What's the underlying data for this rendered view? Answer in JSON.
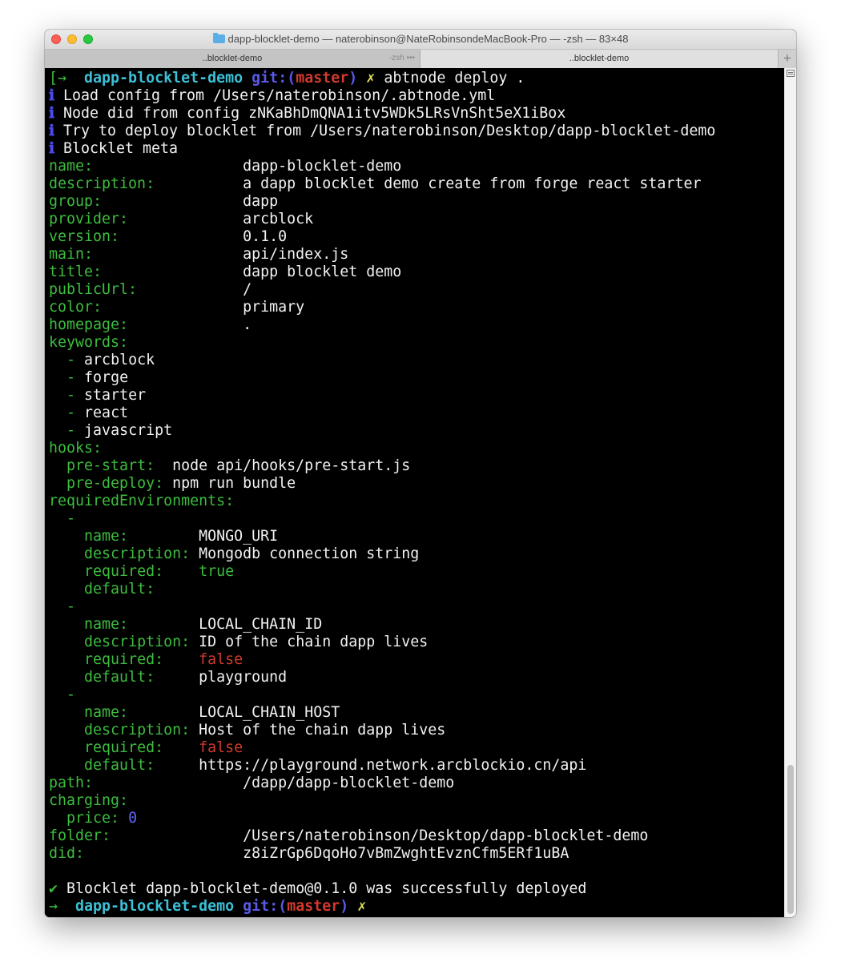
{
  "window": {
    "title": "dapp-blocklet-demo — naterobinson@NateRobinsondeMacBook-Pro — -zsh — 83×48"
  },
  "tabs": [
    {
      "label": "..blocklet-demo",
      "sub": "-zsh •••"
    },
    {
      "label": "..blocklet-demo"
    }
  ],
  "tab_add_label": "+",
  "colors": {
    "prompt_dir": "#3cc0d6",
    "git": "#5a5ae8",
    "branch": "#d23a2c",
    "yaml_key": "#3dbd3d",
    "info_icon": "#4a4af0",
    "false_value": "#d23a2c",
    "number": "#6565ff"
  },
  "terminal": {
    "prompt": {
      "arrow_first": "[→",
      "arrow": "→",
      "dir": "dapp-blocklet-demo",
      "git_open": "git:(",
      "branch": "master",
      "git_close": ")",
      "dirty": "✗",
      "command": "abtnode deploy ."
    },
    "info_icon": "ℹ",
    "info_lines": [
      "Load config from /Users/naterobinson/.abtnode.yml",
      "Node did from config zNKaBhDmQNA1itv5WDk5LRsVnSht5eX1iBox",
      "Try to deploy blocklet from /Users/naterobinson/Desktop/dapp-blocklet-demo",
      "Blocklet meta"
    ],
    "meta": [
      {
        "key": "name:",
        "value": "dapp-blocklet-demo"
      },
      {
        "key": "description:",
        "value": "a dapp blocklet demo create from forge react starter"
      },
      {
        "key": "group:",
        "value": "dapp"
      },
      {
        "key": "provider:",
        "value": "arcblock"
      },
      {
        "key": "version:",
        "value": "0.1.0"
      },
      {
        "key": "main:",
        "value": "api/index.js"
      },
      {
        "key": "title:",
        "value": "dapp blocklet demo"
      },
      {
        "key": "publicUrl:",
        "value": "/"
      },
      {
        "key": "color:",
        "value": "primary"
      },
      {
        "key": "homepage:",
        "value": "."
      }
    ],
    "keywords_key": "keywords:",
    "keywords": [
      "arcblock",
      "forge",
      "starter",
      "react",
      "javascript"
    ],
    "hooks_key": "hooks:",
    "hooks": [
      {
        "key": "pre-start:",
        "value": "node api/hooks/pre-start.js"
      },
      {
        "key": "pre-deploy:",
        "value": "npm run bundle"
      }
    ],
    "env_key": "requiredEnvironments:",
    "env_labels": {
      "name": "name:",
      "description": "description:",
      "required": "required:",
      "default": "default:"
    },
    "environments": [
      {
        "name": "MONGO_URI",
        "description": "Mongodb connection string",
        "required": "true",
        "default": ""
      },
      {
        "name": "LOCAL_CHAIN_ID",
        "description": "ID of the chain dapp lives",
        "required": "false",
        "default": "playground"
      },
      {
        "name": "LOCAL_CHAIN_HOST",
        "description": "Host of the chain dapp lives",
        "required": "false",
        "default": "https://playground.network.arcblockio.cn/api"
      }
    ],
    "path": {
      "key": "path:",
      "value": "/dapp/dapp-blocklet-demo"
    },
    "charging_key": "charging:",
    "price": {
      "key": "price:",
      "value": "0"
    },
    "folder": {
      "key": "folder:",
      "value": "/Users/naterobinson/Desktop/dapp-blocklet-demo"
    },
    "did": {
      "key": "did:",
      "value": "z8iZrGp6DqoHo7vBmZwghtEvznCfm5ERf1uBA"
    },
    "success_icon": "✔",
    "success_text": "Blocklet dapp-blocklet-demo@0.1.0 was successfully deployed"
  }
}
